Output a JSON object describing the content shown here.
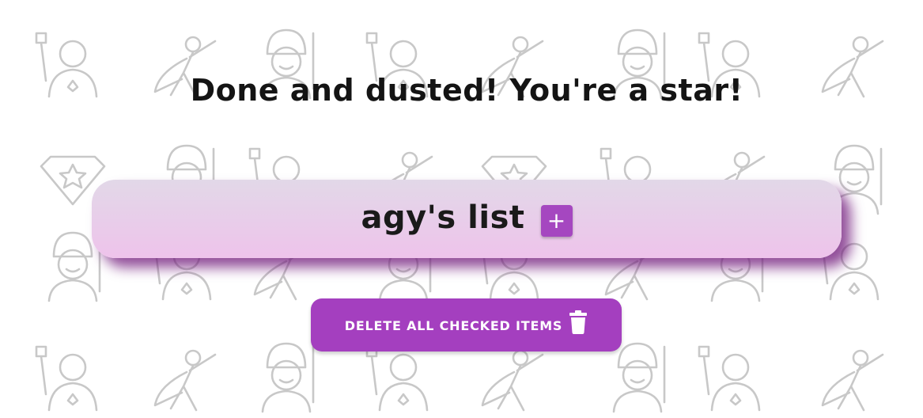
{
  "headline": "Done and dusted! You're a star!",
  "list": {
    "title": "agy's list",
    "add_icon": "plus-icon",
    "add_glyph": "+"
  },
  "actions": {
    "delete_checked_label": "delete all checked items",
    "delete_icon": "trash-icon"
  },
  "colors": {
    "accent": "#a43fbf",
    "card_top": "#e2d8e8",
    "card_bottom": "#eec3eb",
    "card_shadow": "#6e1478",
    "text": "#141414",
    "pattern_stroke": "#c8c8c8"
  },
  "background": {
    "pattern": "superhero-icons"
  }
}
